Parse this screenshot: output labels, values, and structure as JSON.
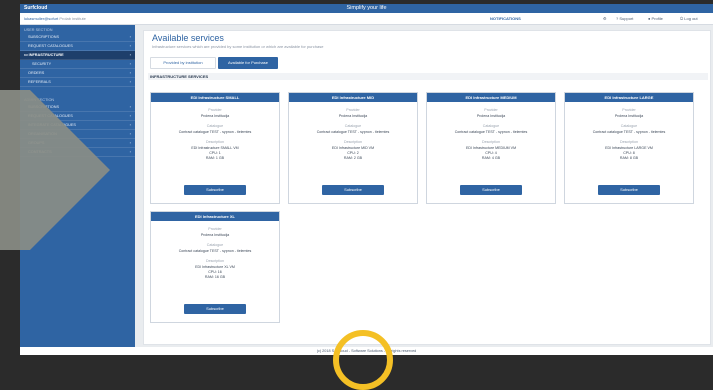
{
  "topbar": {
    "logo": "Surfcloud",
    "tagline": "Simplify your life"
  },
  "header": {
    "user": "lukasmuller@sofurt",
    "org": "Prolab institute",
    "notifications": "NOTIFICATIONS",
    "support": "Support",
    "profile": "Profile",
    "logout": "Log out"
  },
  "sidebar": {
    "user_section": "USER SECTION",
    "user_items": [
      {
        "label": "SUBSCRIPTIONS"
      },
      {
        "label": "REQUEST CATALOGUES"
      },
      {
        "label": "INFRASTRUCTURE"
      },
      {
        "label": "SECURITY"
      },
      {
        "label": "ORDERS"
      },
      {
        "label": "REFERRALS"
      }
    ],
    "admin_section": "ADMIN SECTION",
    "admin_items": [
      {
        "label": "SUBSCRIPTIONS"
      },
      {
        "label": "REQUEST CATALOGUES"
      },
      {
        "label": "INTEGRATE CATALOGUES"
      },
      {
        "label": "ORGANISATION"
      },
      {
        "label": "GROUPS"
      },
      {
        "label": "CONTRACTS"
      }
    ]
  },
  "main": {
    "title": "Available services",
    "subtitle": "Infrastructure services which are provided by some institution or which are available for purchase",
    "tabs": [
      {
        "label": "Provided by institution"
      },
      {
        "label": "Available for Purchase"
      }
    ],
    "section": "INFRASTRUCTURE SERVICES",
    "cards": [
      {
        "title": "EDI Infrastructure SMALL",
        "provider_label": "Provider",
        "provider": "Prolena Institucija",
        "catalogue_label": "Catalogue",
        "catalogue": "Contract catalogue TEST - sypnon - tielemtes",
        "description_label": "Description",
        "d1": "EDI Infrastructure SMALL VM",
        "d2": "CPU: 1",
        "d3": "RAM: 1 GB",
        "button": "Subscribe"
      },
      {
        "title": "EDI Infrastructure MID",
        "provider_label": "Provider",
        "provider": "Prolena Institucija",
        "catalogue_label": "Catalogue",
        "catalogue": "Contract catalogue TEST - sypnon - tielemtes",
        "description_label": "Description",
        "d1": "EDI Infrastructure MID VM",
        "d2": "CPU: 2",
        "d3": "RAM: 2 GB",
        "button": "Subscribe"
      },
      {
        "title": "EDI Infrastructure MEDIUM",
        "provider_label": "Provider",
        "provider": "Prolena Institucija",
        "catalogue_label": "Catalogue",
        "catalogue": "Contract catalogue TEST - sypnon - tielemtes",
        "description_label": "Description",
        "d1": "EDI Infrastructure MEDIUM VM",
        "d2": "CPU: 4",
        "d3": "RAM: 4 GB",
        "button": "Subscribe"
      },
      {
        "title": "EDI Infrastructure LARGE",
        "provider_label": "Provider",
        "provider": "Prolena Institucija",
        "catalogue_label": "Catalogue",
        "catalogue": "Contract catalogue TEST - sypnon - tielemtes",
        "description_label": "Description",
        "d1": "EDI Infrastructure LARGE VM",
        "d2": "CPU: 8",
        "d3": "RAM: 8 GB",
        "button": "Subscribe"
      },
      {
        "title": "EDI Infrastructure XL",
        "provider_label": "Provider",
        "provider": "Prolena Institucija",
        "catalogue_label": "Catalogue",
        "catalogue": "Contract catalogue TEST - sypnon - tielemtes",
        "description_label": "Description",
        "d1": "EDI Infrastructure XL VM",
        "d2": "CPU: 16",
        "d3": "RAM: 16 GB",
        "button": "Subscribe"
      }
    ]
  },
  "footer": {
    "text": "(c) 2018 Surfcloud - Software Solutions - All rights reserved"
  },
  "colors": {
    "brand": "#2f64a3",
    "accent_circle": "#f4c025"
  }
}
